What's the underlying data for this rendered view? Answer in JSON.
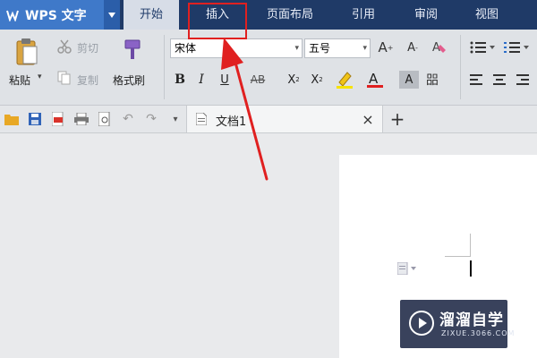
{
  "app": {
    "name": "WPS 文字"
  },
  "tabs": [
    {
      "label": "开始",
      "active": true
    },
    {
      "label": "插入",
      "active": false
    },
    {
      "label": "页面布局",
      "active": false
    },
    {
      "label": "引用",
      "active": false
    },
    {
      "label": "审阅",
      "active": false
    },
    {
      "label": "视图",
      "active": false
    }
  ],
  "clipboard": {
    "paste_label": "粘贴",
    "cut_label": "剪切",
    "copy_label": "复制",
    "format_painter_label": "格式刷"
  },
  "font": {
    "name": "宋体",
    "size": "五号"
  },
  "document": {
    "tab_title": "文档1"
  },
  "watermark": {
    "brand": "溜溜自学",
    "site": "ZIXUE.3066.COM"
  },
  "colors": {
    "title_bar": "#1f3a67",
    "app_button": "#3f79c9",
    "active_tab": "#d7dde7",
    "annotation": "#e02020"
  }
}
